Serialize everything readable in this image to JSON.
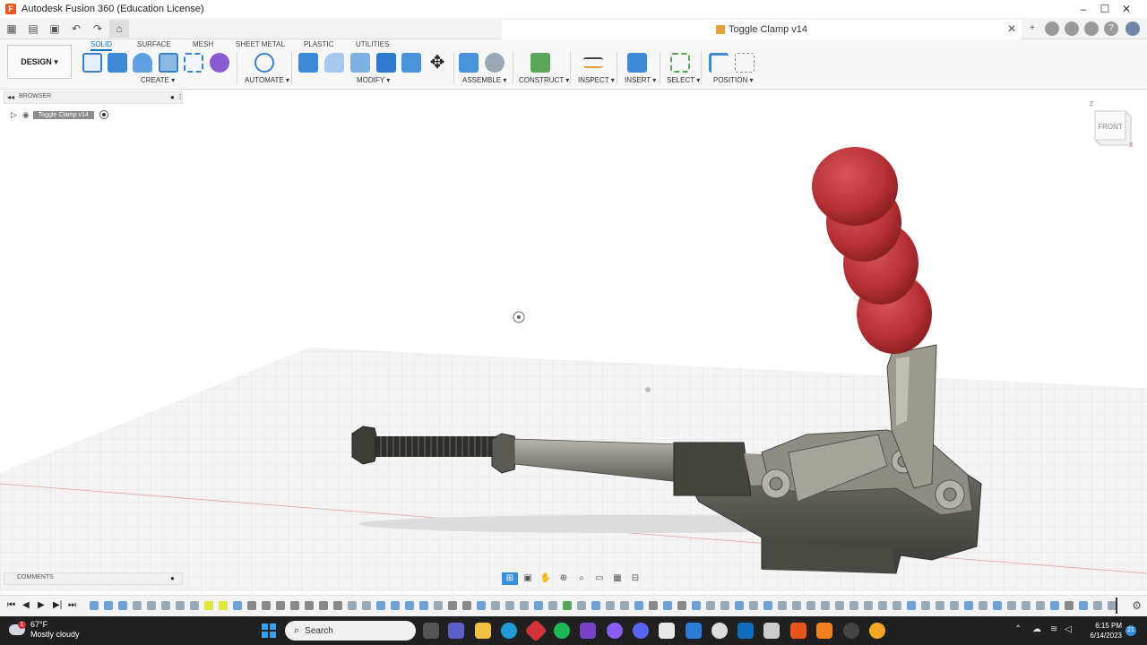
{
  "window": {
    "title": "Autodesk Fusion 360 (Education License)",
    "minimize": "–",
    "maximize": "☐",
    "close": "✕"
  },
  "document_tab": {
    "title": "Toggle Clamp v14",
    "close": "✕"
  },
  "workspace": {
    "label": "DESIGN ▾"
  },
  "ribbon_tabs": [
    "SOLID",
    "SURFACE",
    "MESH",
    "SHEET METAL",
    "PLASTIC",
    "UTILITIES"
  ],
  "ribbon_groups": {
    "create": "CREATE ▾",
    "automate": "AUTOMATE ▾",
    "modify": "MODIFY ▾",
    "assemble": "ASSEMBLE ▾",
    "construct": "CONSTRUCT ▾",
    "inspect": "INSPECT ▾",
    "insert": "INSERT ▾",
    "select": "SELECT ▾",
    "position": "POSITION ▾"
  },
  "browser": {
    "label": "BROWSER",
    "root_node": "Toggle Clamp v14"
  },
  "viewcube": {
    "face": "FRONT",
    "axis_z": "Z",
    "axis_x": "X"
  },
  "comments": {
    "label": "COMMENTS"
  },
  "taskbar": {
    "weather_temp": "67°F",
    "weather_desc": "Mostly cloudy",
    "weather_badge": "1",
    "search_placeholder": "Search",
    "time": "6:15 PM",
    "date": "6/14/2023",
    "notification_count": "21"
  },
  "colors": {
    "accent": "#0a72c9",
    "handle_red": "#c0393e",
    "metal_dark": "#4a4a44",
    "rod_metal": "#8a8780"
  }
}
